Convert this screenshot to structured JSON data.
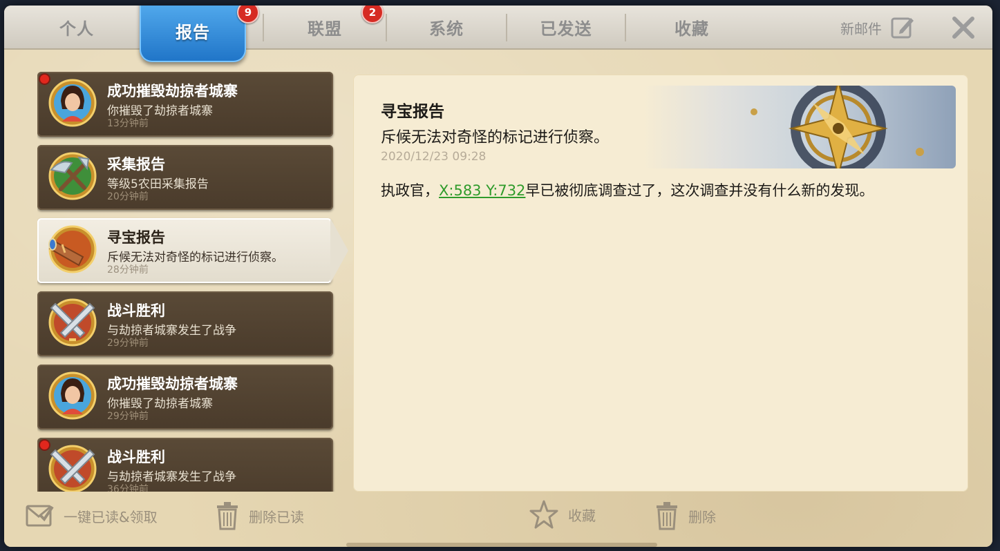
{
  "tabs": [
    {
      "label": "个人"
    },
    {
      "label": "报告",
      "badge": "9"
    },
    {
      "label": "联盟",
      "badge": "2"
    },
    {
      "label": "系统"
    },
    {
      "label": "已发送"
    },
    {
      "label": "收藏"
    }
  ],
  "header": {
    "new_mail_label": "新邮件"
  },
  "reports": [
    {
      "title": "成功摧毁劫掠者城寨",
      "desc": "你摧毁了劫掠者城寨",
      "time": "13分钟前",
      "icon": "governor-avatar-icon",
      "unread": true
    },
    {
      "title": "采集报告",
      "desc": "等级5农田采集报告",
      "time": "20分钟前",
      "icon": "gathering-tools-icon",
      "unread": false
    },
    {
      "title": "寻宝报告",
      "desc": "斥候无法对奇怪的标记进行侦察。",
      "time": "28分钟前",
      "icon": "spyglass-icon",
      "unread": false,
      "selected": true
    },
    {
      "title": "战斗胜利",
      "desc": "与劫掠者城寨发生了战争",
      "time": "29分钟前",
      "icon": "crossed-swords-icon",
      "unread": false
    },
    {
      "title": "成功摧毁劫掠者城寨",
      "desc": "你摧毁了劫掠者城寨",
      "time": "29分钟前",
      "icon": "governor-avatar-icon",
      "unread": false
    },
    {
      "title": "战斗胜利",
      "desc": "与劫掠者城寨发生了战争",
      "time": "36分钟前",
      "icon": "crossed-swords-icon",
      "unread": true
    }
  ],
  "detail": {
    "title": "寻宝报告",
    "subtitle": "斥候无法对奇怪的标记进行侦察。",
    "timestamp": "2020/12/23 09:28",
    "body_prefix": "执政官，",
    "coord_link": "X:583 Y:732",
    "body_suffix": "早已被彻底调查过了，这次调查并没有什么新的发现。"
  },
  "actions": {
    "read_all_label": "一键已读&领取",
    "delete_read_label": "删除已读",
    "favorite_label": "收藏",
    "delete_label": "删除"
  },
  "colors": {
    "active_tab": "#2f8fe0",
    "link": "#2f9b2b",
    "badge": "#d62b23"
  }
}
